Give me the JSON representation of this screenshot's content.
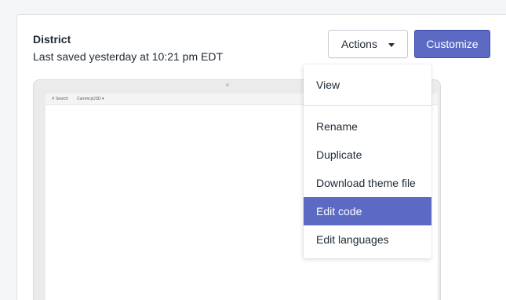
{
  "theme": {
    "name": "District",
    "last_saved": "Last saved yesterday at 10:21 pm EDT"
  },
  "buttons": {
    "actions_label": "Actions",
    "customize_label": "Customize"
  },
  "preview": {
    "search_label": "Search",
    "currency_label": "Currency",
    "currency_value": "USD"
  },
  "actions_menu": {
    "view": "View",
    "rename": "Rename",
    "duplicate": "Duplicate",
    "download": "Download theme file",
    "edit_code": "Edit code",
    "edit_languages": "Edit languages",
    "highlighted_item": "Edit code"
  },
  "colors": {
    "primary": "#5c6ac4",
    "text": "#212b36",
    "background": "#f4f6f8"
  }
}
